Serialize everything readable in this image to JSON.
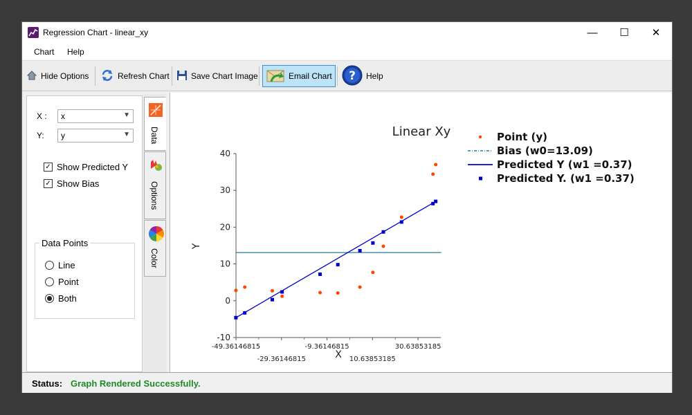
{
  "window": {
    "title": "Regression Chart - linear_xy",
    "controls": {
      "minimize": "—",
      "maximize": "☐",
      "close": "✕"
    }
  },
  "menu": {
    "items": [
      "Chart",
      "Help"
    ]
  },
  "toolbar": {
    "hide_options": "Hide Options",
    "refresh_chart": "Refresh Chart",
    "save_chart_image": "Save  Chart Image",
    "email_chart": "Email Chart",
    "help": "Help"
  },
  "options_panel": {
    "x_label": "X :",
    "x_value": "x",
    "y_label": "Y:",
    "y_value": "y",
    "show_predicted_y": {
      "label": "Show Predicted Y",
      "checked": true
    },
    "show_bias": {
      "label": "Show Bias",
      "checked": true
    },
    "data_points": {
      "title": "Data Points",
      "options": [
        {
          "label": "Line",
          "selected": false
        },
        {
          "label": "Point",
          "selected": false
        },
        {
          "label": "Both",
          "selected": true
        }
      ]
    }
  },
  "side_tabs": [
    {
      "label": "Data",
      "icon": "chart-icon",
      "active": true
    },
    {
      "label": "Options",
      "icon": "palette-icon",
      "active": false
    },
    {
      "label": "Color",
      "icon": "color-wheel-icon",
      "active": false
    }
  ],
  "status": {
    "label": "Status:",
    "text": "Graph Rendered Successfully.",
    "color": "#1f8a2a"
  },
  "chart_data": {
    "type": "scatter",
    "title": "Linear Xy",
    "xlabel": "X",
    "ylabel": "Y",
    "xlim": [
      -49.36146815,
      40.63853185
    ],
    "ylim": [
      -10,
      40
    ],
    "x_tick_labels": [
      "-49.36146815",
      "-29.36146815",
      "-9.36146815",
      "10.63853185",
      "30.63853185"
    ],
    "x_tick_values": [
      -49.36146815,
      -29.36146815,
      -9.36146815,
      10.63853185,
      30.63853185
    ],
    "y_ticks": [
      -10,
      0,
      10,
      20,
      30,
      40
    ],
    "legend": {
      "placement": "right"
    },
    "series": [
      {
        "name": "Point (y)",
        "kind": "points",
        "color": "#ff4500",
        "x": [
          -49.4,
          -45.5,
          -33.4,
          -29.1,
          -12.4,
          -4.6,
          5.1,
          10.8,
          15.4,
          23.4,
          37.2,
          38.4
        ],
        "y": [
          2.8,
          3.7,
          2.7,
          1.2,
          2.2,
          2.1,
          3.7,
          7.7,
          14.8,
          22.7,
          34.4,
          37.0
        ]
      },
      {
        "name": "Bias (w0=13.09)",
        "kind": "hline",
        "color": "#1f7fa0",
        "value": 13.09
      },
      {
        "name": "Predicted Y (w1 =0.37)",
        "kind": "line",
        "color": "#0000cd",
        "x": [
          -49.4,
          38.4
        ],
        "y": [
          -4.6,
          27.0
        ]
      },
      {
        "name": "Predicted Y. (w1 =0.37)",
        "kind": "squares",
        "color": "#0000cd",
        "x": [
          -49.4,
          -45.5,
          -33.4,
          -29.1,
          -12.4,
          -4.6,
          5.1,
          10.8,
          15.4,
          23.4,
          37.2,
          38.4
        ],
        "y": [
          -4.6,
          -3.3,
          0.3,
          2.4,
          7.2,
          9.8,
          13.6,
          15.7,
          18.7,
          21.4,
          26.4,
          27.0
        ]
      }
    ]
  }
}
